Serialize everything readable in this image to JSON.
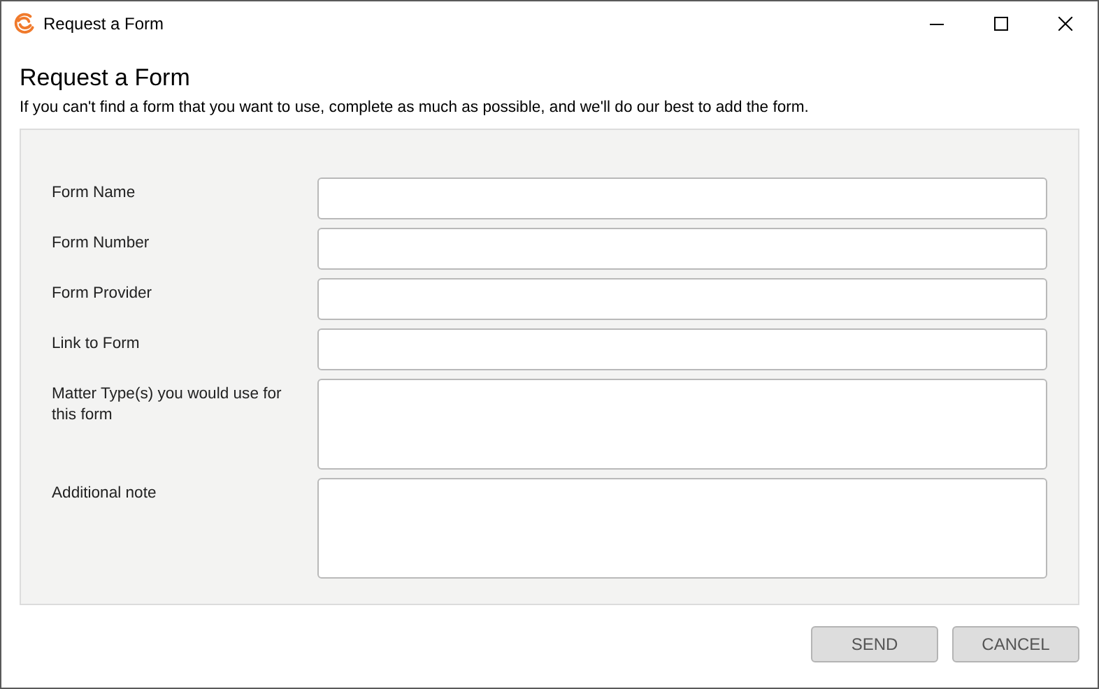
{
  "window": {
    "title": "Request a Form"
  },
  "heading": "Request a Form",
  "intro": "If you can't find a form that you want to use, complete as much as possible, and we'll do our best to add the form.",
  "fields": [
    {
      "label": "Form Name",
      "kind": "line"
    },
    {
      "label": "Form Number",
      "kind": "line"
    },
    {
      "label": "Form Provider",
      "kind": "line"
    },
    {
      "label": "Link to Form",
      "kind": "line"
    },
    {
      "label": "Matter Type(s) you would use for this form",
      "kind": "multiline"
    },
    {
      "label": "Additional note",
      "kind": "note"
    }
  ],
  "buttons": [
    "SEND",
    "CANCEL"
  ]
}
